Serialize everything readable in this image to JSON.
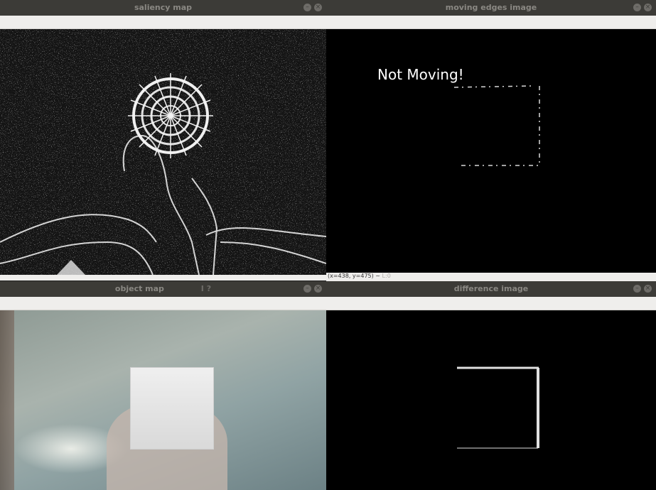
{
  "windows": {
    "saliency": {
      "title": "saliency map"
    },
    "moving_edges": {
      "title": "moving edges image",
      "overlay_text": "Not Moving!",
      "status_coords": "(x=438, y=475) ~",
      "status_value": "L:0"
    },
    "object_map": {
      "title": "object map",
      "title_extra": "I  ?"
    },
    "difference": {
      "title": "difference image"
    }
  },
  "icons": {
    "minimize": "minimize-icon",
    "close": "close-icon"
  },
  "colors": {
    "titlebar": "#3c3b37",
    "title_text": "#8a8883",
    "toolbar": "#efeeec",
    "image_bg": "#000000"
  }
}
